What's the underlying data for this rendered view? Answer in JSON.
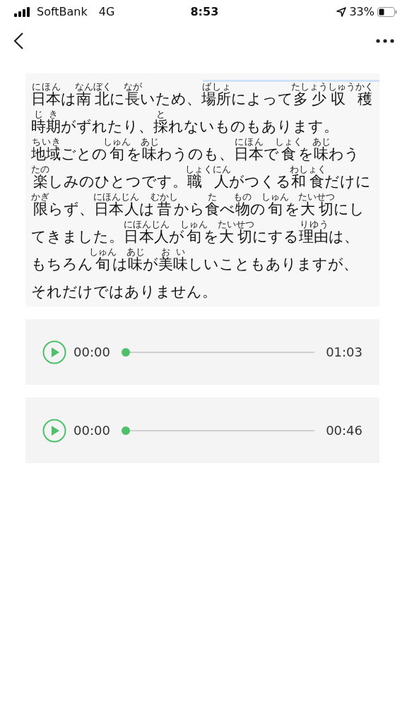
{
  "status_bar": {
    "carrier": "SoftBank",
    "network": "4G",
    "time": "8:53",
    "battery": "33%"
  },
  "text_lines": [
    [
      {
        "t": "日本",
        "r": "にほん"
      },
      {
        "t": "は"
      },
      {
        "t": "南北",
        "r": "なんぼく"
      },
      {
        "t": "に"
      },
      {
        "t": "長",
        "r": "なが"
      },
      {
        "t": "いため、"
      },
      {
        "t": "場所",
        "r": "ばしょ"
      },
      {
        "t": "によって"
      },
      {
        "t": "多少収 穫",
        "r": "たしょうしゅうかく"
      }
    ],
    [
      {
        "t": "時期",
        "r": "じき"
      },
      {
        "t": "がずれたり、"
      },
      {
        "t": "採",
        "r": "と"
      },
      {
        "t": "れないものもあります。"
      }
    ],
    [
      {
        "t": "地域",
        "r": "ちいき"
      },
      {
        "t": "ごとの"
      },
      {
        "t": "旬",
        "r": "しゅん"
      },
      {
        "t": "を"
      },
      {
        "t": "味",
        "r": "あじ"
      },
      {
        "t": "わうのも、"
      },
      {
        "t": "日本",
        "r": "にほん"
      },
      {
        "t": "で"
      },
      {
        "t": "食",
        "r": "しょく"
      },
      {
        "t": "を"
      },
      {
        "t": "味",
        "r": "あじ"
      },
      {
        "t": "わう"
      }
    ],
    [
      {
        "t": "楽",
        "r": "たの"
      },
      {
        "t": "しみのひとつです。"
      },
      {
        "t": "職 人",
        "r": "しょくにん"
      },
      {
        "t": "がつくる"
      },
      {
        "t": "和食",
        "r": "わしょく"
      },
      {
        "t": "だけに"
      }
    ],
    [
      {
        "t": "限",
        "r": "かぎ"
      },
      {
        "t": "らず、"
      },
      {
        "t": "日本人",
        "r": "にほんじん"
      },
      {
        "t": "は"
      },
      {
        "t": "昔",
        "r": "むかし"
      },
      {
        "t": "から"
      },
      {
        "t": "食",
        "r": "た"
      },
      {
        "t": "べ"
      },
      {
        "t": "物",
        "r": "もの"
      },
      {
        "t": "の"
      },
      {
        "t": "旬",
        "r": "しゅん"
      },
      {
        "t": "を"
      },
      {
        "t": "大切",
        "r": "たいせつ"
      },
      {
        "t": "にし"
      }
    ],
    [
      {
        "t": "てきました。"
      },
      {
        "t": "日本人",
        "r": "にほんじん"
      },
      {
        "t": "が"
      },
      {
        "t": "旬",
        "r": "しゅん"
      },
      {
        "t": "を"
      },
      {
        "t": "大切",
        "r": "たいせつ"
      },
      {
        "t": "にする"
      },
      {
        "t": "理由",
        "r": "りゆう"
      },
      {
        "t": "は、"
      }
    ],
    [
      {
        "t": "もちろん"
      },
      {
        "t": "旬",
        "r": "しゅん"
      },
      {
        "t": "は"
      },
      {
        "t": "味",
        "r": "あじ"
      },
      {
        "t": "が"
      },
      {
        "t": "美味",
        "r": "おい"
      },
      {
        "t": "しいこともありますが、"
      }
    ],
    [
      {
        "t": "それだけではありません。"
      }
    ]
  ],
  "players": [
    {
      "current": "00:00",
      "duration": "01:03",
      "level": 0
    },
    {
      "current": "00:00",
      "duration": "00:46",
      "level": 0
    }
  ]
}
